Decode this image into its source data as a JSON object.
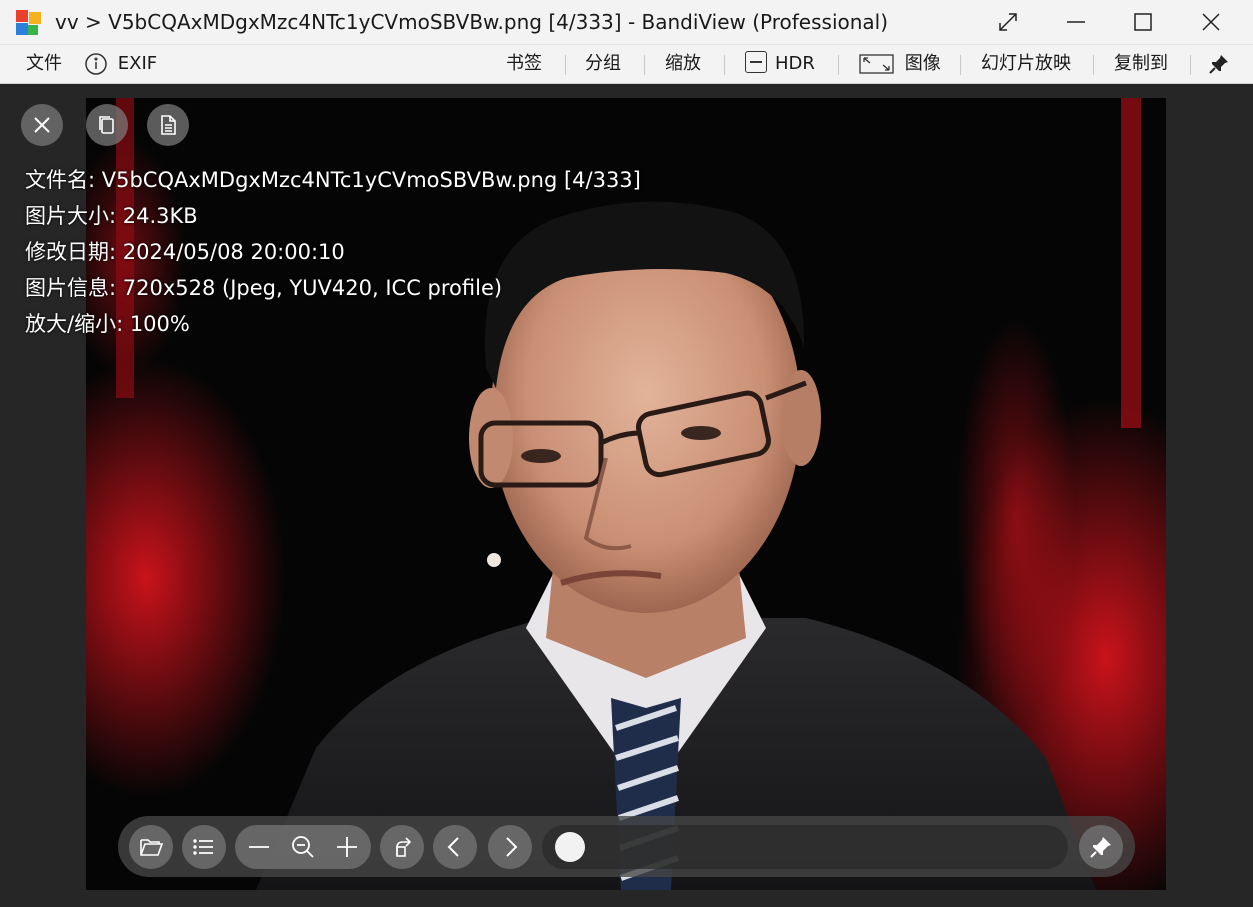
{
  "window": {
    "title": "vv > V5bCQAxMDgxMzc4NTc1yCVmoSBVBw.png [4/333] - BandiView (Professional)"
  },
  "menubar": {
    "file": "文件",
    "exif": "EXIF",
    "bookmark": "书签",
    "group": "分组",
    "zoom": "缩放",
    "hdr": "HDR",
    "image": "图像",
    "slideshow": "幻灯片放映",
    "copy_to": "复制到"
  },
  "info": {
    "filename": "文件名: V5bCQAxMDgxMzc4NTc1yCVmoSBVBw.png [4/333]",
    "filesize": "图片大小: 24.3KB",
    "modified": "修改日期: 2024/05/08 20:00:10",
    "imageinfo": "图片信息: 720x528 (Jpeg, YUV420, ICC profile)",
    "zoom": "放大/缩小: 100%"
  },
  "toolbar": {
    "slider_position": 0.0
  },
  "colors": {
    "titlebar_bg": "#f3f3f3",
    "viewer_bg": "#262626",
    "stage_red": "#c8121a"
  }
}
